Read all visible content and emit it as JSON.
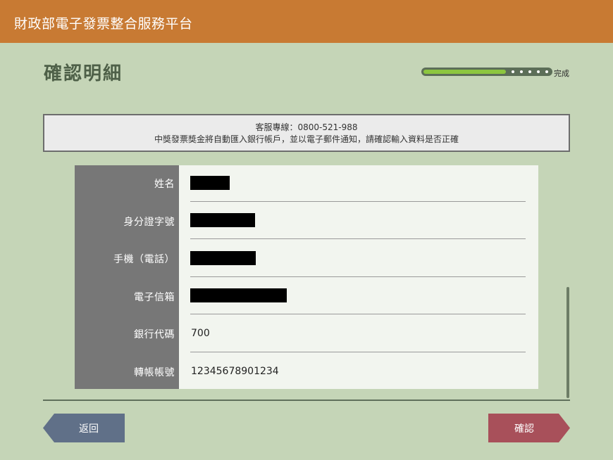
{
  "header": {
    "app_title": "財政部電子發票整合服務平台",
    "background_color": "#c87a33"
  },
  "page": {
    "title": "確認明細"
  },
  "progress": {
    "label": "完成",
    "fraction": 0.65,
    "steps_remaining": 5
  },
  "notice": {
    "hotline": "客服專線：0800-521-988",
    "message": "中獎發票獎金將自動匯入銀行帳戶，並以電子郵件通知，請確認輸入資料是否正確"
  },
  "details": {
    "rows": [
      {
        "label": "姓名",
        "value": "",
        "redacted": true
      },
      {
        "label": "身分證字號",
        "value": "",
        "redacted": true
      },
      {
        "label": "手機（電話）",
        "value": "",
        "redacted": true
      },
      {
        "label": "電子信箱",
        "value": "",
        "redacted": true
      },
      {
        "label": "銀行代碼",
        "value": "700",
        "redacted": false
      },
      {
        "label": "轉帳帳號",
        "value": "12345678901234",
        "redacted": false
      }
    ]
  },
  "buttons": {
    "back_label": "返回",
    "confirm_label": "確認"
  }
}
